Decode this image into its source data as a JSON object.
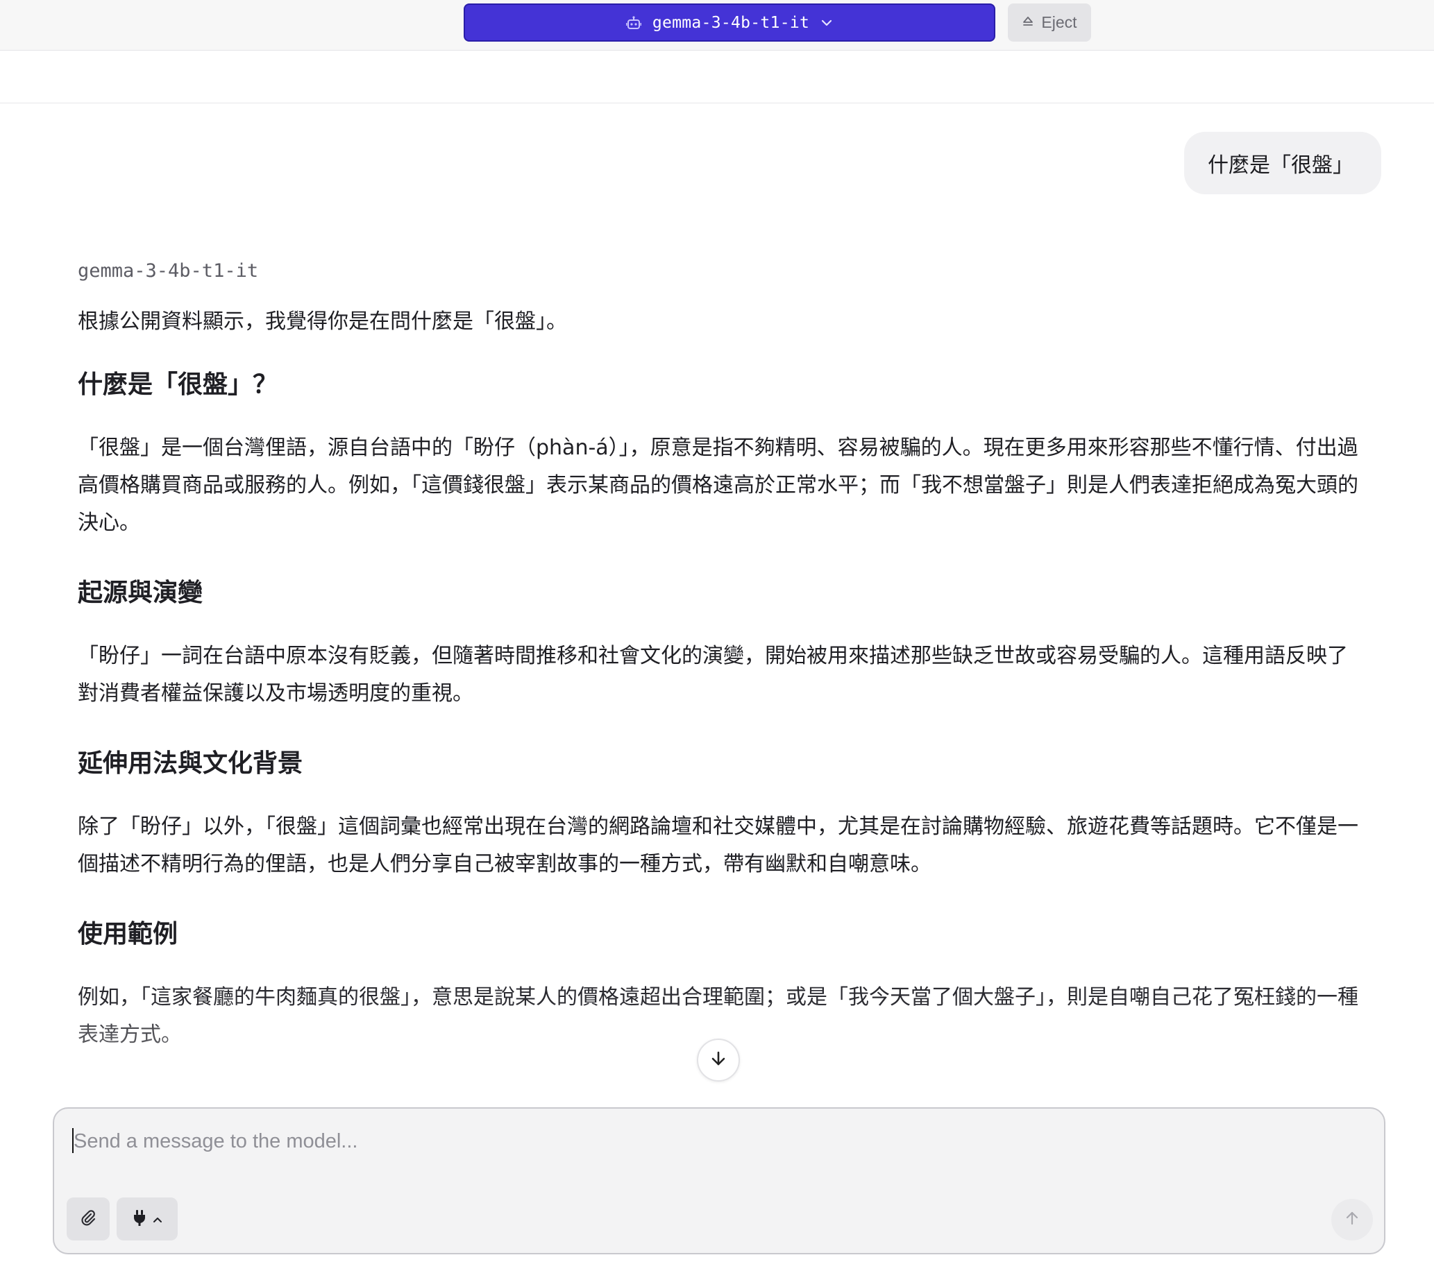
{
  "header": {
    "model_name": "gemma-3-4b-t1-it",
    "eject_label": "Eject",
    "model_icon": "robot-icon",
    "dropdown_icon": "chevron-down-icon",
    "eject_icon": "eject-icon",
    "accent_color": "#4433d6"
  },
  "chat": {
    "user_message": "什麼是「很盤」",
    "assistant": {
      "name": "gemma-3-4b-t1-it",
      "intro": "根據公開資料顯示，我覺得你是在問什麼是「很盤」。",
      "sections": [
        {
          "heading": "什麼是「很盤」？",
          "paragraph": "「很盤」是一個台灣俚語，源自台語中的「盼仔（phàn-á）」，原意是指不夠精明、容易被騙的人。現在更多用來形容那些不懂行情、付出過高價格購買商品或服務的人。例如，「這價錢很盤」表示某商品的價格遠高於正常水平；而「我不想當盤子」則是人們表達拒絕成為冤大頭的決心。"
        },
        {
          "heading": "起源與演變",
          "paragraph": "「盼仔」一詞在台語中原本沒有貶義，但隨著時間推移和社會文化的演變，開始被用來描述那些缺乏世故或容易受騙的人。這種用語反映了對消費者權益保護以及市場透明度的重視。"
        },
        {
          "heading": "延伸用法與文化背景",
          "paragraph": "除了「盼仔」以外，「很盤」這個詞彙也經常出現在台灣的網路論壇和社交媒體中，尤其是在討論購物經驗、旅遊花費等話題時。它不僅是一個描述不精明行為的俚語，也是人們分享自己被宰割故事的一種方式，帶有幽默和自嘲意味。"
        },
        {
          "heading": "使用範例",
          "paragraph": "例如，「這家餐廳的牛肉麵真的很盤」，意思是說某人的價格遠超出合理範圍；或是「我今天當了個大盤子」，則是自嘲自己花了冤枉錢的一種表達方式。"
        }
      ]
    },
    "scroll_icon": "arrow-down-icon"
  },
  "composer": {
    "placeholder": "Send a message to the model...",
    "value": "",
    "attach_icon": "paperclip-icon",
    "plugins_icon": "plug-icon",
    "plugins_chevron_icon": "chevron-up-icon",
    "send_icon": "arrow-up-icon"
  }
}
